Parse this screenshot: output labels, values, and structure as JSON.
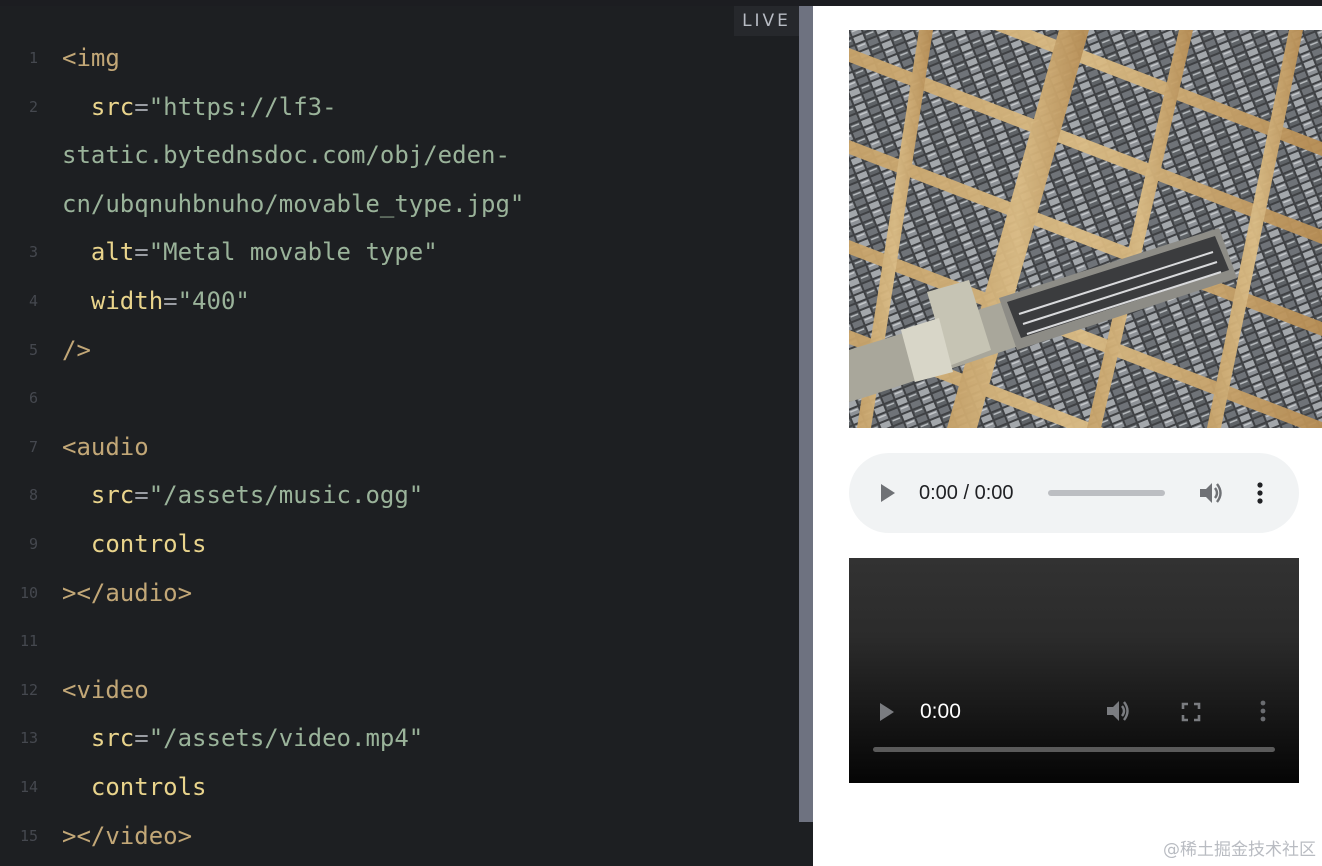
{
  "editor": {
    "live_badge": "LIVE",
    "lines": [
      {
        "num": "1",
        "parts": [
          {
            "t": "tag",
            "v": "<img"
          }
        ]
      },
      {
        "num": "2",
        "parts": [
          {
            "t": "attr",
            "v": "  src"
          },
          {
            "t": "eq",
            "v": "="
          },
          {
            "t": "str",
            "v": "\"https://lf3-"
          }
        ]
      },
      {
        "num": "",
        "parts": [
          {
            "t": "str",
            "v": "static.bytednsdoc.com/obj/eden-"
          }
        ]
      },
      {
        "num": "",
        "parts": [
          {
            "t": "str",
            "v": "cn/ubqnuhbnuho/movable_type.jpg\""
          }
        ]
      },
      {
        "num": "3",
        "parts": [
          {
            "t": "attr",
            "v": "  alt"
          },
          {
            "t": "eq",
            "v": "="
          },
          {
            "t": "str",
            "v": "\"Metal movable type\""
          }
        ]
      },
      {
        "num": "4",
        "parts": [
          {
            "t": "attr",
            "v": "  width"
          },
          {
            "t": "eq",
            "v": "="
          },
          {
            "t": "str",
            "v": "\"400\""
          }
        ]
      },
      {
        "num": "5",
        "parts": [
          {
            "t": "tag",
            "v": "/>"
          }
        ]
      },
      {
        "num": "6",
        "parts": []
      },
      {
        "num": "7",
        "parts": [
          {
            "t": "tag",
            "v": "<audio"
          }
        ]
      },
      {
        "num": "8",
        "parts": [
          {
            "t": "attr",
            "v": "  src"
          },
          {
            "t": "eq",
            "v": "="
          },
          {
            "t": "str",
            "v": "\"/assets/music.ogg\""
          }
        ]
      },
      {
        "num": "9",
        "parts": [
          {
            "t": "attr",
            "v": "  controls"
          }
        ]
      },
      {
        "num": "10",
        "parts": [
          {
            "t": "tag",
            "v": "></audio>"
          }
        ]
      },
      {
        "num": "11",
        "parts": []
      },
      {
        "num": "12",
        "parts": [
          {
            "t": "tag",
            "v": "<video"
          }
        ]
      },
      {
        "num": "13",
        "parts": [
          {
            "t": "attr",
            "v": "  src"
          },
          {
            "t": "eq",
            "v": "="
          },
          {
            "t": "str",
            "v": "\"/assets/video.mp4\""
          }
        ]
      },
      {
        "num": "14",
        "parts": [
          {
            "t": "attr",
            "v": "  controls"
          }
        ]
      },
      {
        "num": "15",
        "parts": [
          {
            "t": "tag",
            "v": "></video>"
          }
        ]
      }
    ]
  },
  "preview": {
    "audio": {
      "time": "0:00 / 0:00",
      "progress": 0,
      "icons": [
        "play-icon",
        "volume-icon",
        "more-options-icon"
      ]
    },
    "video": {
      "time": "0:00",
      "progress": 0,
      "icons": [
        "play-icon",
        "volume-icon",
        "fullscreen-icon",
        "more-options-icon"
      ]
    }
  },
  "watermark": "@稀土掘金技术社区",
  "colors": {
    "editor_bg": "#1d1f22",
    "tag": "#c2a777",
    "attr": "#e9d48c",
    "string": "#9ab39a",
    "line_number": "#45484f"
  }
}
